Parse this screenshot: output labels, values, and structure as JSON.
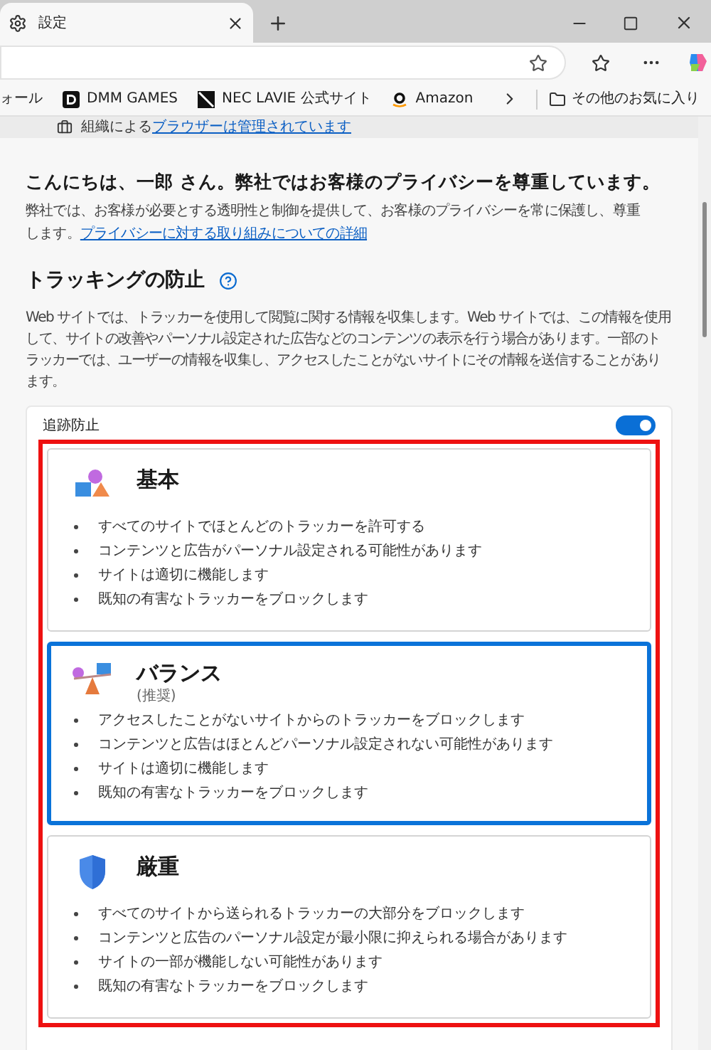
{
  "tab": {
    "title": "設定"
  },
  "bookmarks": [
    {
      "label": "ォール",
      "kind": "plain"
    },
    {
      "label": "DMM GAMES",
      "kind": "dmm"
    },
    {
      "label": "NEC LAVIE 公式サイト",
      "kind": "nec"
    },
    {
      "label": "Amazon",
      "kind": "amazon"
    }
  ],
  "other_favorites": "その他のお気に入り",
  "managed_banner": {
    "text": "組織による",
    "link": "ブラウザーは管理されています"
  },
  "greeting": "こんにちは、一郎 さん。弊社ではお客様のプライバシーを尊重しています。",
  "intro": {
    "text": "弊社では、お客様が必要とする透明性と制御を提供して、お客様のプライバシーを常に保護し、尊重します。",
    "link": "プライバシーに対する取り組みについての詳細"
  },
  "tracking": {
    "title": "トラッキングの防止",
    "description": "Web サイトでは、トラッカーを使用して閲覧に関する情報を収集します。Web サイトでは、この情報を使用して、サイトの改善やパーソナル設定された広告などのコンテンツの表示を行う場合があります。一部のトラッカーでは、ユーザーの情報を収集し、アクセスしたことがないサイトにその情報を送信することがあります。",
    "toggle": {
      "label": "追跡防止",
      "on": true
    },
    "levels": [
      {
        "kind": "basic",
        "title": "基本",
        "selected": false,
        "points": [
          "すべてのサイトでほとんどのトラッカーを許可する",
          "コンテンツと広告がパーソナル設定される可能性があります",
          "サイトは適切に機能します",
          "既知の有害なトラッカーをブロックします"
        ]
      },
      {
        "kind": "balanced",
        "title": "バランス",
        "subtitle": "(推奨)",
        "selected": true,
        "points": [
          "アクセスしたことがないサイトからのトラッカーをブロックします",
          "コンテンツと広告はほとんどパーソナル設定されない可能性があります",
          "サイトは適切に機能します",
          "既知の有害なトラッカーをブロックします"
        ]
      },
      {
        "kind": "strict",
        "title": "厳重",
        "selected": false,
        "points": [
          "すべてのサイトから送られるトラッカーの大部分をブロックします",
          "コンテンツと広告のパーソナル設定が最小限に抑えられる場合があります",
          "サイトの一部が機能しない可能性があります",
          "既知の有害なトラッカーをブロックします"
        ]
      }
    ]
  }
}
